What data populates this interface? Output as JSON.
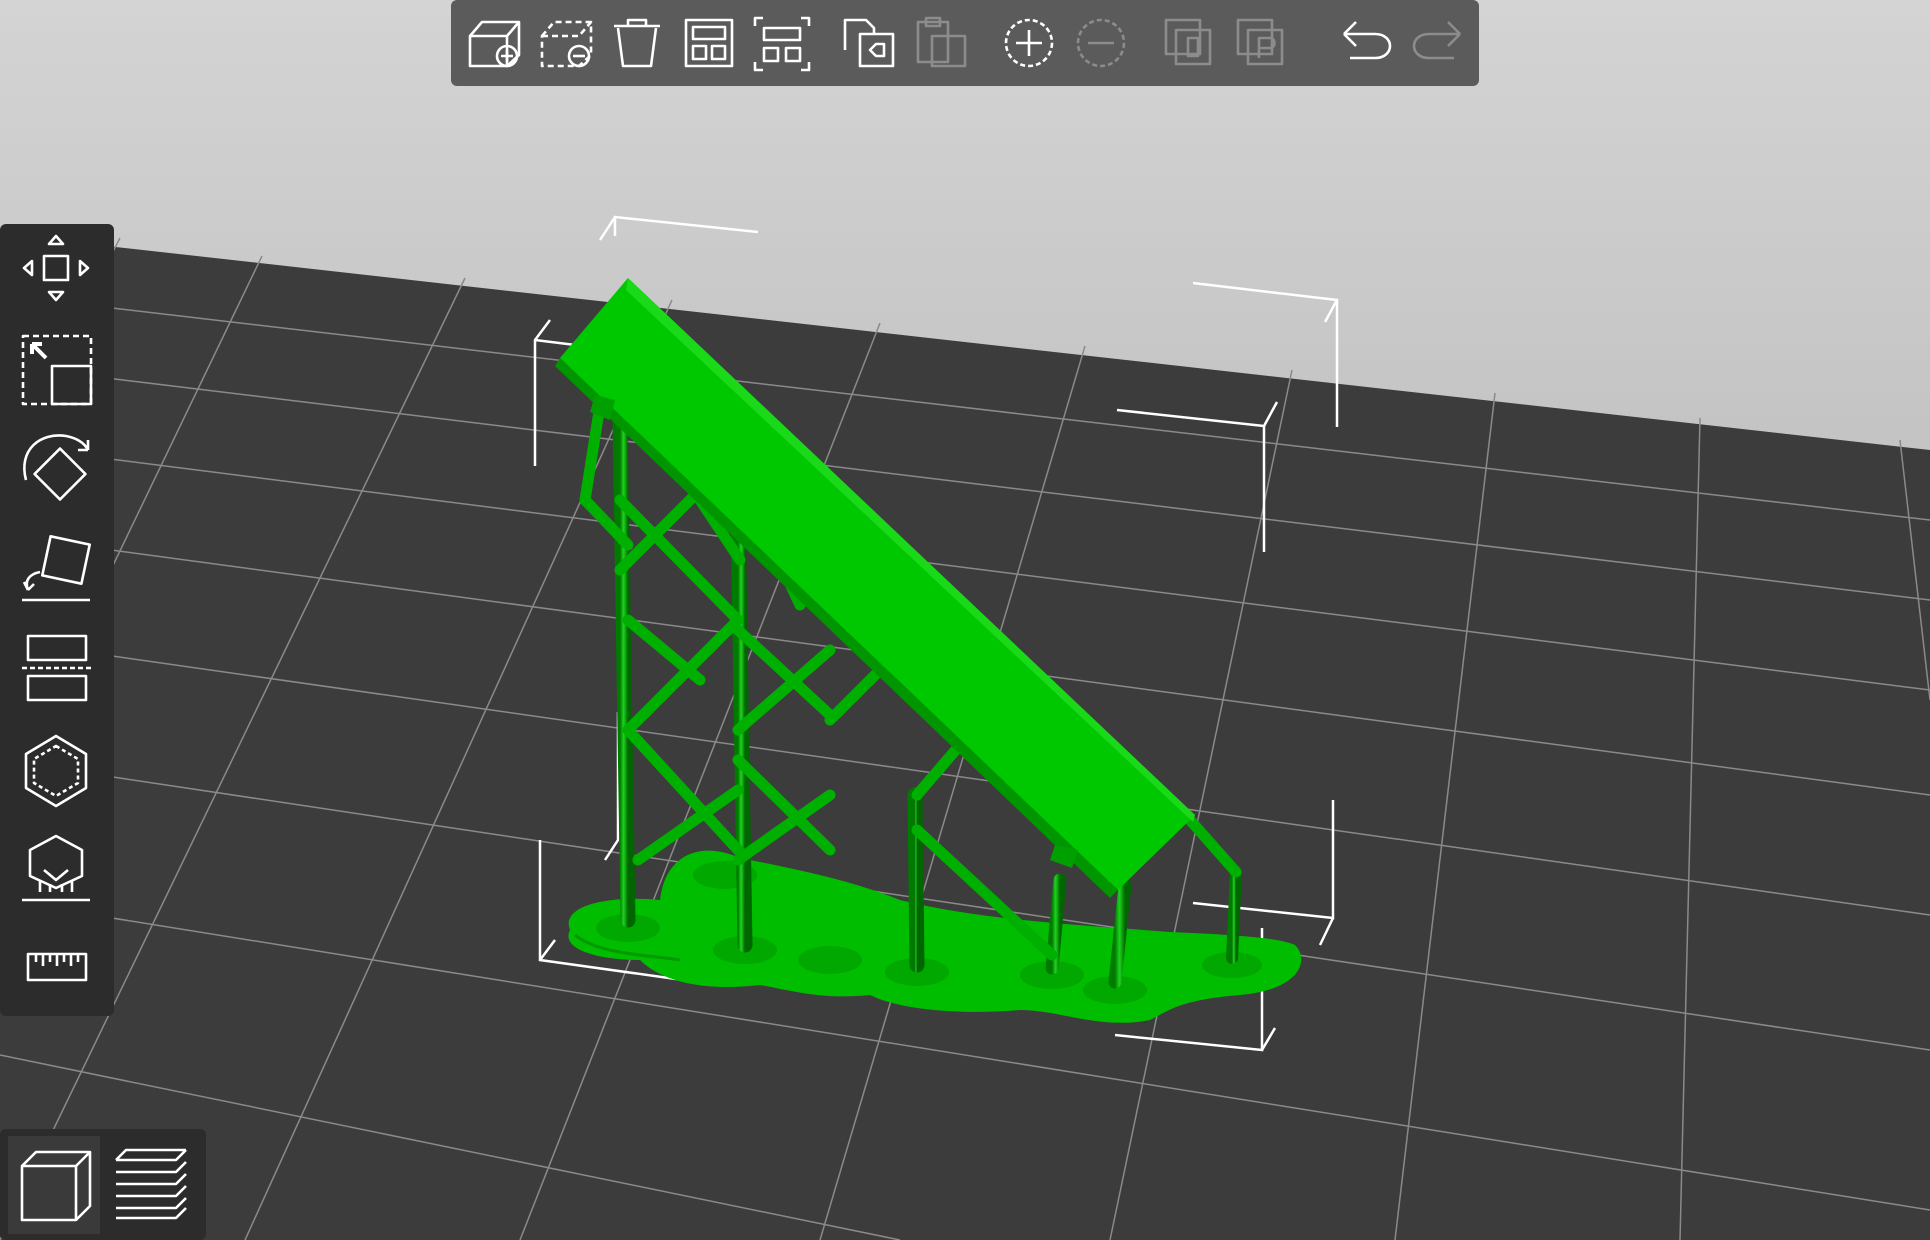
{
  "app": {
    "accent_color": "#00c000",
    "background_color": "#3a3a3a"
  },
  "viewport": {
    "model": {
      "color": "#00c000",
      "description_icon": "model-with-supports"
    }
  },
  "top_toolbar": {
    "buttons": [
      {
        "icon": "add-object-icon",
        "enabled": true
      },
      {
        "icon": "remove-object-icon",
        "enabled": true
      },
      {
        "icon": "delete-icon",
        "enabled": true
      },
      {
        "icon": "arrange-icon",
        "enabled": true
      },
      {
        "icon": "arrange-selection-icon",
        "enabled": true
      },
      {
        "icon": "copy-settings-icon",
        "enabled": true
      },
      {
        "icon": "paste-settings-icon",
        "enabled": false
      },
      {
        "icon": "add-instance-icon",
        "enabled": true
      },
      {
        "icon": "remove-instance-icon",
        "enabled": false
      },
      {
        "icon": "split-to-objects-icon",
        "enabled": false
      },
      {
        "icon": "split-to-parts-icon",
        "enabled": false
      },
      {
        "icon": "undo-icon",
        "enabled": true
      },
      {
        "icon": "redo-icon",
        "enabled": false
      }
    ]
  },
  "left_toolbar": {
    "tools": [
      {
        "icon": "move-icon"
      },
      {
        "icon": "scale-icon"
      },
      {
        "icon": "rotate-icon"
      },
      {
        "icon": "place-on-face-icon"
      },
      {
        "icon": "cut-icon"
      },
      {
        "icon": "hollow-icon"
      },
      {
        "icon": "support-points-icon"
      },
      {
        "icon": "measure-icon"
      }
    ]
  },
  "view_switch": {
    "options": [
      {
        "icon": "3d-view-icon",
        "active": true
      },
      {
        "icon": "preview-layers-icon",
        "active": false
      }
    ]
  }
}
